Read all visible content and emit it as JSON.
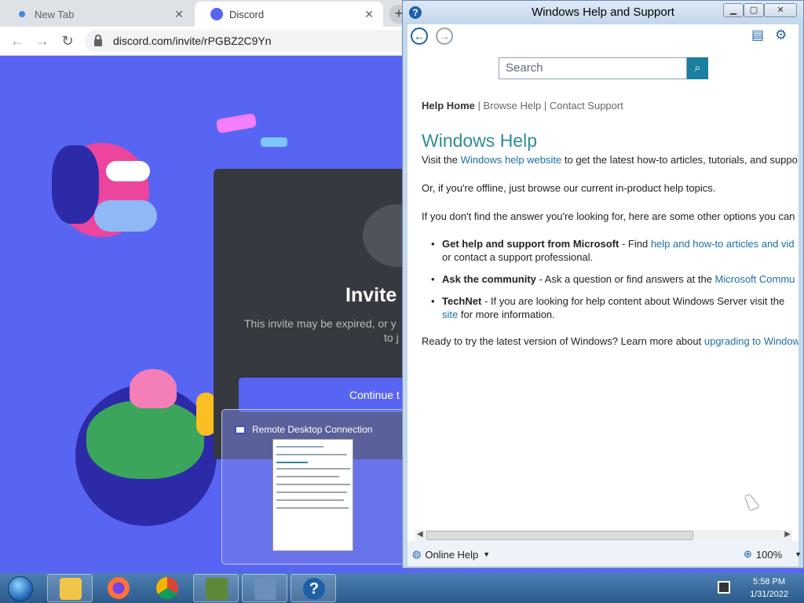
{
  "chrome": {
    "tabs": [
      {
        "label": "New Tab"
      },
      {
        "label": "Discord"
      }
    ],
    "close_glyph": "✕",
    "newtab_glyph": "+",
    "url": "discord.com/invite/rPGBZ2C9Yn"
  },
  "discord": {
    "invite_title": "Invite",
    "invite_sub_line1": "This invite may be expired, or y",
    "invite_sub_line2": "to j",
    "continue_label": "Continue t"
  },
  "thumbnail": {
    "title": "Remote Desktop Connection"
  },
  "help_window": {
    "title": "Windows Help and Support",
    "search_placeholder": "Search",
    "breadcrumbs": {
      "home": "Help Home",
      "sep": "|",
      "browse": "Browse Help",
      "contact": "Contact Support"
    },
    "heading": "Windows Help",
    "para1_pre": "Visit the ",
    "para1_link": "Windows help website",
    "para1_post": " to get the latest how-to articles, tutorials, and suppo",
    "para2": "Or, if you're offline, just browse our current in-product help topics.",
    "para3": "If you don't find the answer you're looking for, here are some other options you can",
    "bullets": [
      {
        "bold": "Get help and support from Microsoft",
        "text": " - Find ",
        "link": "help and how-to articles and vid",
        "line2": "or contact a support professional."
      },
      {
        "bold": "Ask the community",
        "text": " - Ask a question or find answers at the ",
        "link": "Microsoft Commu"
      },
      {
        "bold": "TechNet",
        "text": " - If you are looking for help content about Windows Server visit the",
        "line2_link": "site",
        "line2": " for more information."
      }
    ],
    "para4_pre": "Ready to try the latest version of Windows? Learn more about ",
    "para4_link": "upgrading to Window",
    "status_left": "Online Help",
    "zoom": "100%"
  },
  "taskbar": {
    "time": "5:58 PM",
    "date": "1/31/2022"
  },
  "colors": {
    "discord_blurple": "#5865f2",
    "help_link": "#1a6fa3",
    "help_heading": "#2e8b9a"
  }
}
